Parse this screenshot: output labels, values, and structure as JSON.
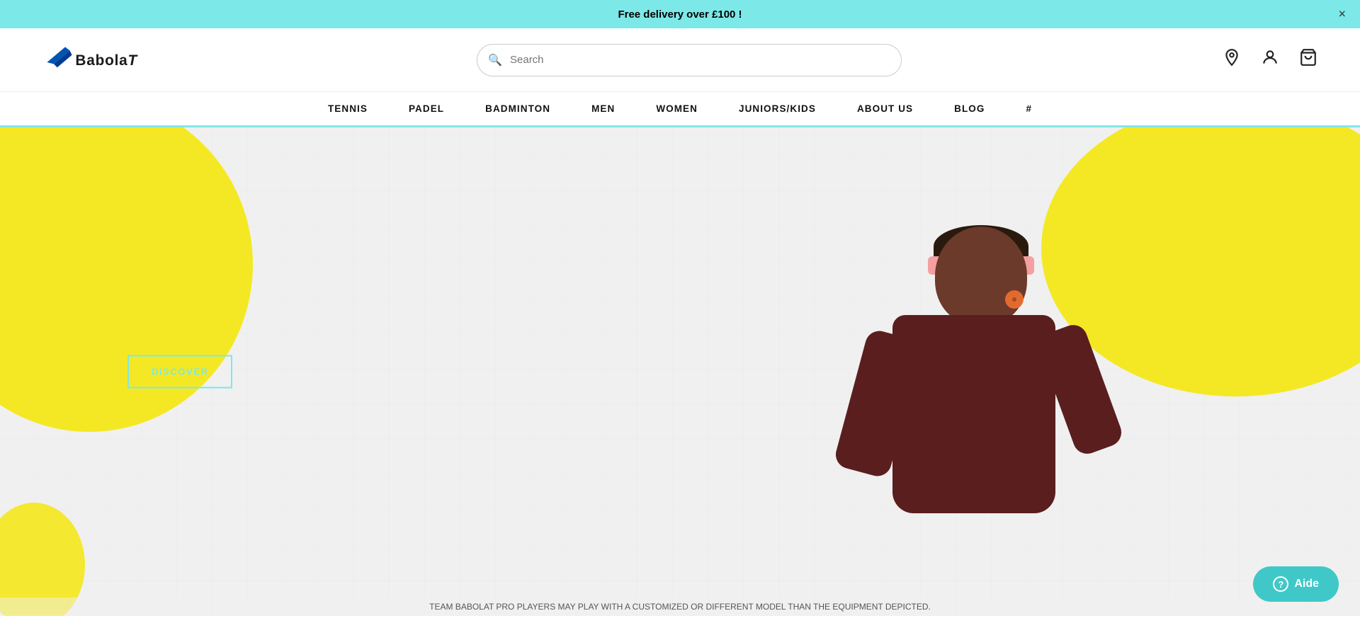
{
  "announcement": {
    "text": "Free delivery over £100 !",
    "close_label": "×"
  },
  "header": {
    "logo_alt": "Babolat",
    "search_placeholder": "Search"
  },
  "nav": {
    "items": [
      {
        "label": "TENNIS"
      },
      {
        "label": "PADEL"
      },
      {
        "label": "BADMINTON"
      },
      {
        "label": "MEN"
      },
      {
        "label": "WOMEN"
      },
      {
        "label": "JUNIORS/KIDS"
      },
      {
        "label": "ABOUT US"
      },
      {
        "label": "BLOG"
      },
      {
        "label": "#"
      }
    ]
  },
  "hero": {
    "discover_label": "DISCOVER",
    "caption": "TEAM BABOLAT PRO PLAYERS MAY PLAY WITH A CUSTOMIZED OR DIFFERENT MODEL THAN THE EQUIPMENT DEPICTED.",
    "aide_label": "Aide"
  }
}
